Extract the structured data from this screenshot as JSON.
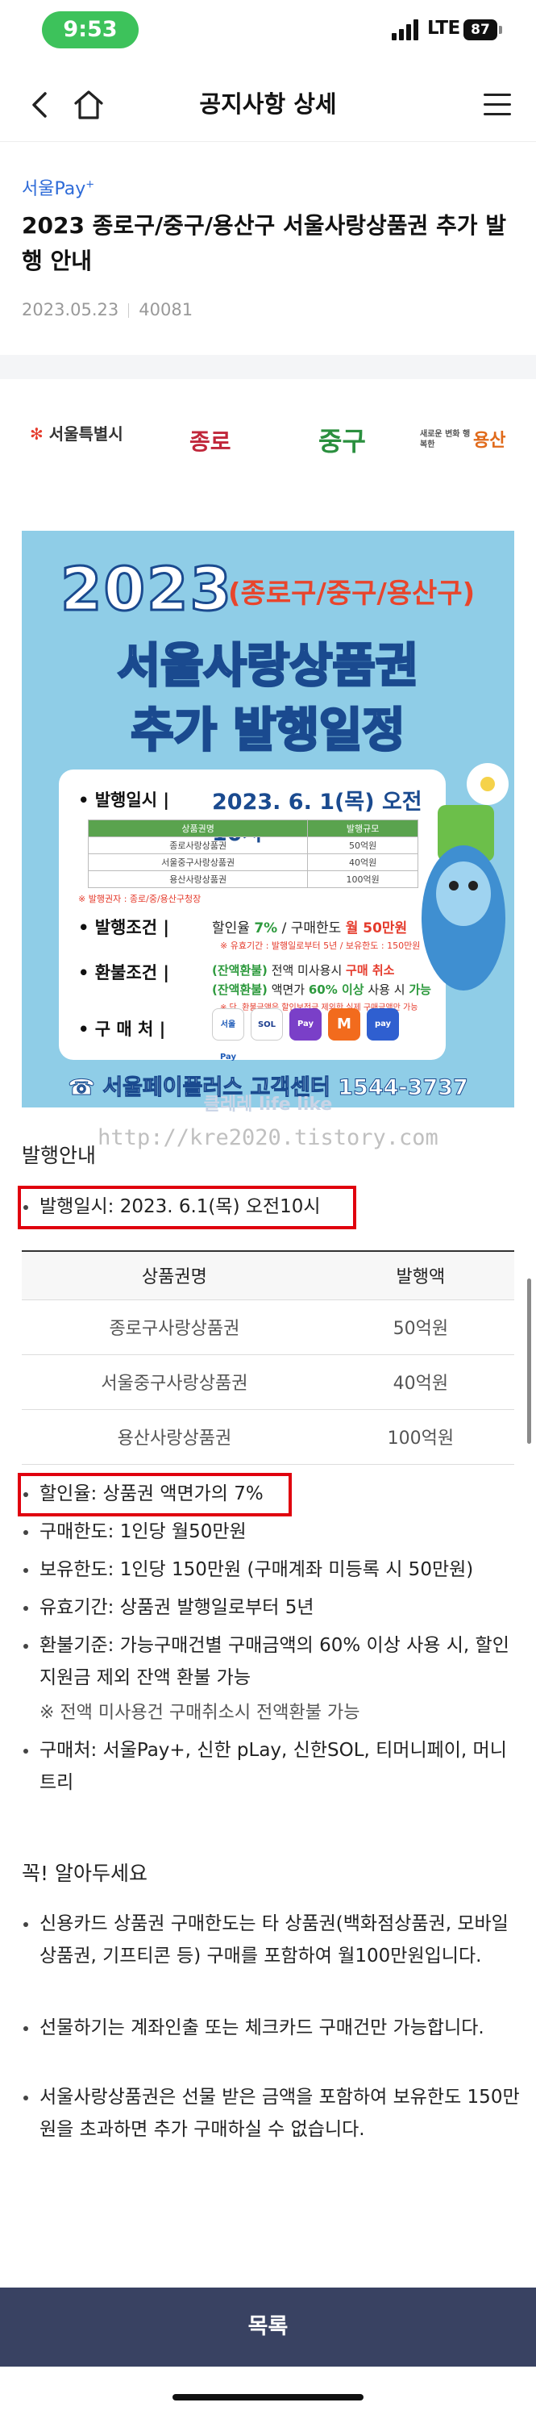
{
  "status": {
    "time": "9:53",
    "network": "LTE",
    "battery": "87"
  },
  "nav": {
    "title": "공지사항 상세"
  },
  "article": {
    "category": "서울Pay",
    "category_sup": "+",
    "title": "2023 종로구/중구/용산구 서울사랑상품권 추가 발행 안내",
    "date": "2023.05.23",
    "views": "40081"
  },
  "poster": {
    "logo_seoul": "서울특별시",
    "logo_jongno": "종로",
    "logo_junggu": "중구",
    "logo_yongsan_small": "새로운 변화 행복한",
    "logo_yongsan": "용산",
    "year": "2023",
    "districts": "(종로구/중구/용산구)",
    "main_title_1": "서울사랑상품권",
    "main_title_2": "추가 발행일정",
    "date_label": "발행일시 |",
    "date_value": "2023. 6. 1(목) 오전10시",
    "table_headers": [
      "상품권명",
      "발행규모"
    ],
    "table_rows": [
      [
        "종로사랑상품권",
        "50억원"
      ],
      [
        "서울중구사랑상품권",
        "40억원"
      ],
      [
        "용산사랑상품권",
        "100억원"
      ]
    ],
    "issuer_note": "※ 발행권자 : 종로/중/용산구청장",
    "cond_label": "발행조건 |",
    "cond_value_a": "할인율 ",
    "cond_value_b": "7%",
    "cond_value_c": " / 구매한도 ",
    "cond_value_d": "월 50만원",
    "cond_note": "※ 유효기간 : 발행일로부터 5년 / 보유한도 : 150만원",
    "refund_label": "환불조건 |",
    "refund_line1_a": "(잔액환불)",
    "refund_line1_b": " 전액 미사용시 ",
    "refund_line1_c": "구매 취소",
    "refund_line2_a": "(잔액환불)",
    "refund_line2_b": " 액면가 ",
    "refund_line2_c": "60% 이상",
    "refund_line2_d": " 사용 시 ",
    "refund_line2_e": "가능",
    "refund_note": "※ 단, 환불금액은 할인보전금 제외한 실제 구매금액만 가능",
    "buy_label": "구 매 처 |",
    "buy_chips": [
      "서울Pay",
      "SOL",
      "Pay",
      "M",
      "pay"
    ],
    "footer": "☎ 서울페이플러스 고객센터 1544-3737"
  },
  "watermark": {
    "line1": "클레레 life like",
    "line2": "http://kre2020.tistory.com"
  },
  "section": {
    "heading": "발행안내",
    "issue_date": "발행일시: 2023. 6.1(목) 오전10시",
    "table": {
      "headers": [
        "상품권명",
        "발행액"
      ],
      "rows": [
        [
          "종로구사랑상품권",
          "50억원"
        ],
        [
          "서울중구사랑상품권",
          "40억원"
        ],
        [
          "용산사랑상품권",
          "100억원"
        ]
      ]
    },
    "bullets": [
      "할인율: 상품권 액면가의 7%",
      "구매한도: 1인당 월50만원",
      "보유한도: 1인당 150만원 (구매계좌 미등록 시 50만원)",
      "유효기간: 상품권 발행일로부터 5년",
      "환불기준: 가능구매건별 구매금액의 60% 이상 사용 시, 할인지원금 제외 잔액 환불 가능",
      "※ 전액 미사용건 구매취소시 전액환불 가능",
      "구매처: 서울Pay+, 신한 pLay, 신한SOL, 티머니페이, 머니트리"
    ]
  },
  "notice": {
    "heading": "꼭! 알아두세요",
    "items": [
      "신용카드 상품권 구매한도는 타 상품권(백화점상품권, 모바일상품권, 기프티콘 등) 구매를 포함하여 월100만원입니다.",
      "선물하기는 계좌인출 또는 체크카드 구매건만 가능합니다.",
      "서울사랑상품권은 선물 받은 금액을 포함하여 보유한도 150만원을 초과하면 추가 구매하실 수 없습니다."
    ]
  },
  "footer": {
    "list_button": "목록"
  }
}
